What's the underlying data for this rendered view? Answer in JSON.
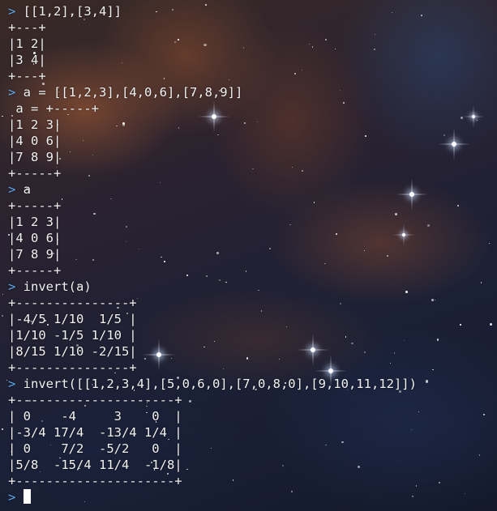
{
  "terminal": {
    "prompt_symbol": ">",
    "lines": [
      {
        "kind": "input",
        "text": "[[1,2],[3,4]]"
      },
      {
        "kind": "output",
        "text": "+---+"
      },
      {
        "kind": "output",
        "text": "|1 2|"
      },
      {
        "kind": "output",
        "text": "|3 4|"
      },
      {
        "kind": "output",
        "text": "+---+"
      },
      {
        "kind": "input",
        "text": "a = [[1,2,3],[4,0,6],[7,8,9]]"
      },
      {
        "kind": "output",
        "text": " a = +-----+"
      },
      {
        "kind": "output",
        "text": "|1 2 3|"
      },
      {
        "kind": "output",
        "text": "|4 0 6|"
      },
      {
        "kind": "output",
        "text": "|7 8 9|"
      },
      {
        "kind": "output",
        "text": "+-----+"
      },
      {
        "kind": "input",
        "text": "a"
      },
      {
        "kind": "output",
        "text": "+-----+"
      },
      {
        "kind": "output",
        "text": "|1 2 3|"
      },
      {
        "kind": "output",
        "text": "|4 0 6|"
      },
      {
        "kind": "output",
        "text": "|7 8 9|"
      },
      {
        "kind": "output",
        "text": "+-----+"
      },
      {
        "kind": "input",
        "text": "invert(a)"
      },
      {
        "kind": "output",
        "text": "+---------------+"
      },
      {
        "kind": "output",
        "text": "|-4/5 1/10  1/5 |"
      },
      {
        "kind": "output",
        "text": "|1/10 -1/5 1/10 |"
      },
      {
        "kind": "output",
        "text": "|8/15 1/10 -2/15|"
      },
      {
        "kind": "output",
        "text": "+---------------+"
      },
      {
        "kind": "input",
        "text": "invert([[1,2,3,4],[5,0,6,0],[7,0,8,0],[9,10,11,12]])"
      },
      {
        "kind": "output",
        "text": "+---------------------+"
      },
      {
        "kind": "output",
        "text": "| 0    -4     3    0  |"
      },
      {
        "kind": "output",
        "text": "|-3/4 17/4  -13/4 1/4 |"
      },
      {
        "kind": "output",
        "text": "| 0    7/2  -5/2   0  |"
      },
      {
        "kind": "output",
        "text": "|5/8  -15/4 11/4  -1/8|"
      },
      {
        "kind": "output",
        "text": "+---------------------+"
      }
    ],
    "current_input": ""
  },
  "colors": {
    "prompt": "#5fa8e8",
    "text": "#f2f2f2",
    "cursor": "#ffffff"
  }
}
